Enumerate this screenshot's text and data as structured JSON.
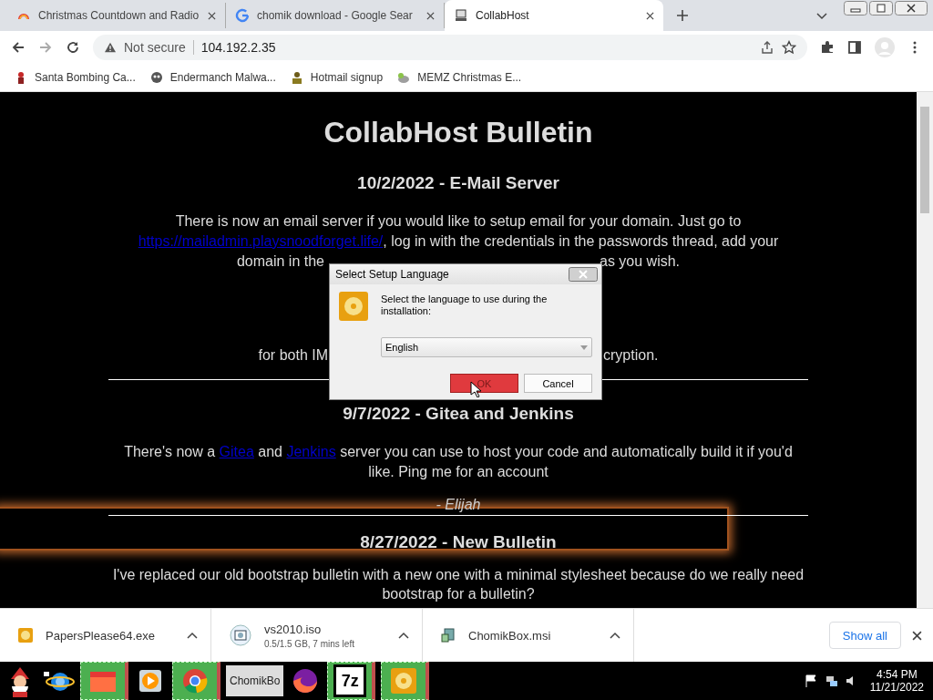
{
  "tabs": [
    {
      "title": "Christmas Countdown and Radio",
      "selected": false
    },
    {
      "title": "chomik download - Google Sear",
      "selected": false
    },
    {
      "title": "CollabHost",
      "selected": true
    }
  ],
  "address": {
    "security": "Not secure",
    "url": "104.192.2.35"
  },
  "bookmarks": [
    "Santa Bombing Ca...",
    "Endermanch Malwa...",
    "Hotmail signup",
    "MEMZ Christmas E..."
  ],
  "page": {
    "title": "CollabHost Bulletin",
    "post1": {
      "heading": "10/2/2022 - E-Mail Server",
      "line1": "There is now an email server if you would like to setup email for your domain. Just go to",
      "link": "https://mailadmin.playsnoodforget.life/",
      "line2": ", log in with the credentials in the passwords thread, add your",
      "line3_left": "domain in the",
      "line3_right": "as you wish.",
      "line4_left": "for both IM",
      "line4_right": "cryption."
    },
    "post2": {
      "heading": "9/7/2022 - Gitea and Jenkins",
      "before": "There's now a ",
      "link1": "Gitea",
      "middle": " and ",
      "link2": "Jenkins",
      "after": " server you can use to host your code and automatically build it if you'd like. Ping me for an account",
      "signature": "- Elijah"
    },
    "post3": {
      "heading": "8/27/2022 - New Bulletin",
      "text": "I've replaced our old bootstrap bulletin with a new one with a minimal stylesheet because do we really need bootstrap for a bulletin?"
    }
  },
  "dialog": {
    "title": "Select Setup Language",
    "message": "Select the language to use during the installation:",
    "language": "English",
    "ok": "OK",
    "cancel": "Cancel"
  },
  "downloads": [
    {
      "name": "PapersPlease64.exe"
    },
    {
      "name": "vs2010.iso",
      "status": "0.5/1.5 GB, 7 mins left"
    },
    {
      "name": "ChomikBox.msi"
    }
  ],
  "show_all": "Show all",
  "taskbar": {
    "label": "ChomikBo",
    "zip_label": "7z",
    "time": "4:54 PM",
    "date": "11/21/2022"
  }
}
